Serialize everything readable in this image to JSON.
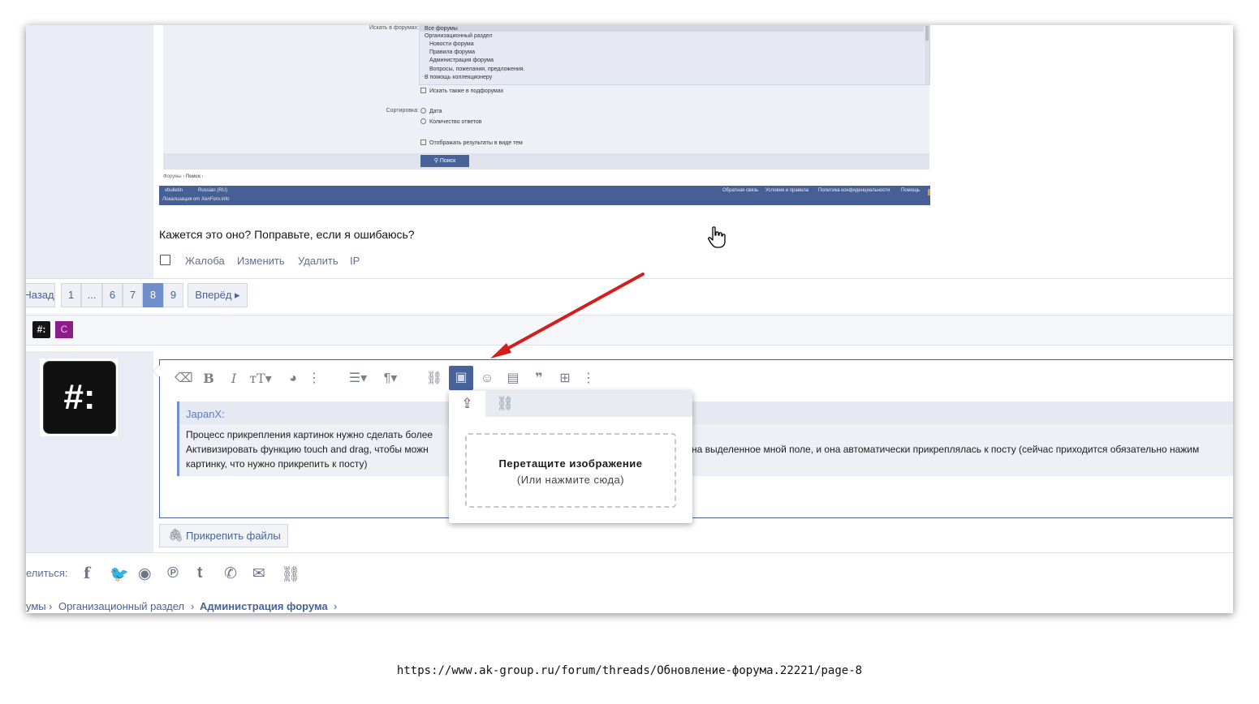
{
  "embedded_screenshot": {
    "label_search_in": "Искать в форумах:",
    "forum_options": [
      "Все форумы",
      "Организационный раздел",
      "Новости форума",
      "Правила форума",
      "Администрация форума",
      "Вопросы, пожелания, предложения.",
      "В помощь коллекционеру"
    ],
    "search_subforums": "Искать также в подфорумах",
    "label_sort": "Сортировка:",
    "sort_date": "Дата",
    "sort_replies": "Количество ответов",
    "show_as_threads": "Отображать результаты в виде тем",
    "search_button": "Поиск",
    "breadcrumb_forums": "Форумы",
    "breadcrumb_search": "Поиск",
    "footer_brand": "vbulletin",
    "footer_lang": "Russian (RU)",
    "footer_localization": "Локализация от XenForo.info",
    "footer_links": [
      "Обратная связь",
      "Условия и правила",
      "Политика конфиденциальности",
      "Помощь"
    ]
  },
  "post": {
    "text": "Кажется это оно? Поправьте, если я ошибаюсь?",
    "actions": [
      "Жалоба",
      "Изменить",
      "Удалить",
      "IP"
    ]
  },
  "pagination": {
    "prev": "Назад",
    "pages": [
      "1",
      "...",
      "6",
      "7",
      "8",
      "9"
    ],
    "current": "8",
    "next": "Вперёд"
  },
  "tags": {
    "first": "#:",
    "second": "C"
  },
  "avatar_text": "#:",
  "quote": {
    "author": "JapanX:",
    "line1": "Процесс прикрепления картинок нужно сделать более",
    "line2a": "Активизировать функцию touch and drag, чтобы можн",
    "line2b": "на выделенное мной поле, и она автоматически прикреплялась к посту (сейчас приходится обязательно нажим",
    "line3": "картинку, что нужно прикрепить к посту)"
  },
  "attach_label": "Прикрепить файлы",
  "popup": {
    "drop_title": "Перетащите изображение",
    "drop_hint": "(Или нажмите сюда)"
  },
  "share": {
    "label": "елиться:",
    "icons": [
      "facebook-icon",
      "twitter-icon",
      "reddit-icon",
      "pinterest-icon",
      "tumblr-icon",
      "whatsapp-icon",
      "email-icon",
      "link-icon"
    ]
  },
  "breadcrumbs": [
    "умы",
    "Организационный раздел",
    "Администрация форума"
  ],
  "url": "https://www.ak-group.ru/forum/threads/Обновление-форума.22221/page-8",
  "colors": {
    "accent": "#47639a",
    "annotation_arrow": "#d41e1e",
    "active_page": "#6f8fcc"
  }
}
